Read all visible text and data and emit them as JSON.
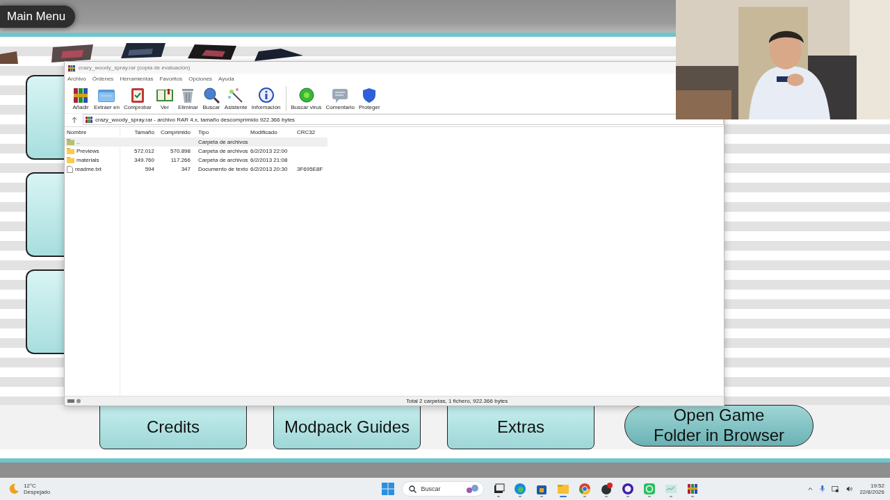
{
  "game": {
    "title": "Main Menu",
    "buttons": [
      {
        "lines": [
          "Credits"
        ],
        "kind": "box"
      },
      {
        "lines": [
          "Modpack Guides"
        ],
        "kind": "box"
      },
      {
        "lines": [
          "Extras"
        ],
        "kind": "box"
      },
      {
        "lines": [
          "Open Game",
          "Folder in Browser"
        ],
        "kind": "pill"
      }
    ]
  },
  "winrar": {
    "title": "crazy_woody_spray.rar (copia de evaluación)",
    "menu": [
      "Archivo",
      "Órdenes",
      "Herramientas",
      "Favoritos",
      "Opciones",
      "Ayuda"
    ],
    "toolbar": [
      {
        "label": "Añadir",
        "kind": "add"
      },
      {
        "label": "Extraer en",
        "kind": "extract"
      },
      {
        "label": "Comprobar",
        "kind": "test"
      },
      {
        "label": "Ver",
        "kind": "view"
      },
      {
        "label": "Eliminar",
        "kind": "delete"
      },
      {
        "label": "Buscar",
        "kind": "find"
      },
      {
        "label": "Asistente",
        "kind": "wizard"
      },
      {
        "label": "Información",
        "kind": "info"
      },
      {
        "label": "Buscar virus",
        "kind": "virus"
      },
      {
        "label": "Comentario",
        "kind": "comment"
      },
      {
        "label": "Proteger",
        "kind": "protect"
      }
    ],
    "path": "crazy_woody_spray.rar - archivo RAR 4.x, tamaño descomprimido 922.366 bytes",
    "columns": [
      "Nombre",
      "Tamaño",
      "Comprimido",
      "Tipo",
      "Modificado",
      "CRC32"
    ],
    "rows": [
      {
        "kind": "parent",
        "selected": true,
        "cells": [
          "..",
          "",
          "",
          "Carpeta de archivos",
          "",
          ""
        ]
      },
      {
        "kind": "folder",
        "selected": false,
        "cells": [
          "Previews",
          "572.012",
          "570.898",
          "Carpeta de archivos",
          "6/2/2013 22:00",
          ""
        ]
      },
      {
        "kind": "folder",
        "selected": false,
        "cells": [
          "materials",
          "349.760",
          "117.266",
          "Carpeta de archivos",
          "6/2/2013 21:08",
          ""
        ]
      },
      {
        "kind": "file",
        "selected": false,
        "cells": [
          "readme.txt",
          "594",
          "347",
          "Documento de texto",
          "6/2/2013 20:30",
          "3F695E8F"
        ]
      }
    ],
    "status": "Total 2 carpetas, 1 fichero, 922.366 bytes"
  },
  "taskbar": {
    "temperature": "12°C",
    "condition": "Despejado",
    "search": {
      "placeholder": "Buscar"
    },
    "apps": [
      {
        "kind": "taskview",
        "active": false
      },
      {
        "kind": "edge",
        "active": false
      },
      {
        "kind": "store",
        "active": false
      },
      {
        "kind": "explorer",
        "active": true
      },
      {
        "kind": "chrome",
        "active": false
      },
      {
        "kind": "obs",
        "active": false
      },
      {
        "kind": "ring",
        "active": false
      },
      {
        "kind": "whatsapp",
        "active": false
      },
      {
        "kind": "monitor",
        "active": false
      },
      {
        "kind": "winrar",
        "active": false
      }
    ],
    "time": "19:52",
    "date": "22/8/2026"
  }
}
